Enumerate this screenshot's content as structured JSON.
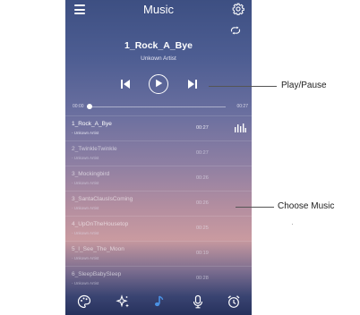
{
  "app": {
    "title": "Music"
  },
  "now_playing": {
    "title": "1_Rock_A_Bye",
    "artist": "Unkown Artist"
  },
  "progress": {
    "elapsed": "00:00",
    "total": "00:27",
    "fraction": 0.02
  },
  "tracks": [
    {
      "name": "1_Rock_A_Bye",
      "artist": "- Unkown Artist",
      "duration": "00:27",
      "playing": true
    },
    {
      "name": "2_TwinkleTwinkle",
      "artist": "- Unkown Artist",
      "duration": "00:27",
      "playing": false
    },
    {
      "name": "3_Mockingbird",
      "artist": "- Unkown Artist",
      "duration": "00:26",
      "playing": false
    },
    {
      "name": "3_SantaClausIsComing",
      "artist": "- Unkown Artist",
      "duration": "00:26",
      "playing": false
    },
    {
      "name": "4_UpOnTheHousetop",
      "artist": "- Unkown Artist",
      "duration": "00:25",
      "playing": false
    },
    {
      "name": "5_I_See_The_Moon",
      "artist": "- Unkown Artist",
      "duration": "00:19",
      "playing": false
    },
    {
      "name": "6_SleepBabySleep",
      "artist": "- Unkown Artist",
      "duration": "00:28",
      "playing": false
    }
  ],
  "annotations": {
    "play_pause": "Play/Pause",
    "choose_music": "Choose Music"
  },
  "icons": {
    "menu": "menu-icon",
    "settings": "gear-icon",
    "repeat": "repeat-icon",
    "prev": "skip-previous-icon",
    "play": "play-icon",
    "next": "skip-next-icon",
    "equalizer": "equalizer-icon",
    "nav": [
      "palette-icon",
      "sparkle-icon",
      "music-note-icon",
      "microphone-icon",
      "alarm-clock-icon"
    ]
  },
  "colors": {
    "accent_active_nav": "#4a90e2",
    "text": "#ffffff"
  }
}
